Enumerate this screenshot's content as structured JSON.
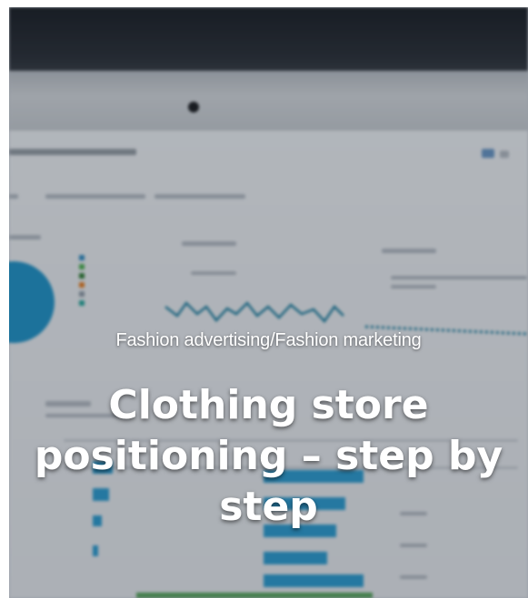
{
  "card": {
    "category": "Fashion advertising/Fashion marketing",
    "title": "Clothing store positioning – step by step",
    "background": "blurred photo of a laptop screen showing a web analytics dashboard"
  },
  "colors": {
    "accent_blue": "#2b9cd0",
    "title_text": "#ffffff",
    "green_bar": "#58a55c"
  }
}
